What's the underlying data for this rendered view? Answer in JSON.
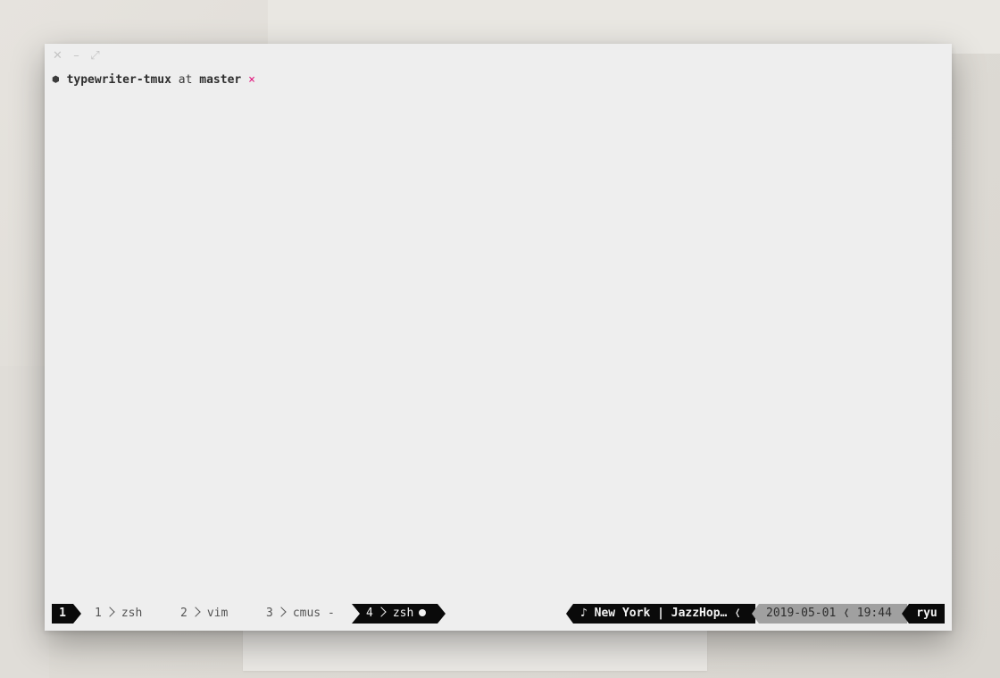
{
  "titlebar": {
    "close_glyph": "✕",
    "minimize_glyph": "–",
    "maximize_glyph": "⤢"
  },
  "prompt": {
    "marker": "⬢",
    "repo": "typewriter-tmux",
    "at": "at",
    "branch": "master",
    "dirty": "×"
  },
  "status": {
    "session": "1",
    "windows": [
      {
        "index": "1",
        "name": "zsh",
        "flag": ""
      },
      {
        "index": "2",
        "name": "vim",
        "flag": ""
      },
      {
        "index": "3",
        "name": "cmus",
        "flag": "-"
      },
      {
        "index": "4",
        "name": "zsh",
        "flag": "●",
        "active": true
      }
    ],
    "now_playing": "♪ New York | JazzHop…",
    "now_playing_sep": "❬",
    "date": "2019-05-01",
    "date_time_sep": "❬",
    "time": "19:44",
    "user": "ryu"
  },
  "colors": {
    "window_bg": "#eeeeee",
    "status_black": "#0a0a0a",
    "status_gray": "#a0a0a0",
    "dirty_accent": "#e0127a"
  }
}
